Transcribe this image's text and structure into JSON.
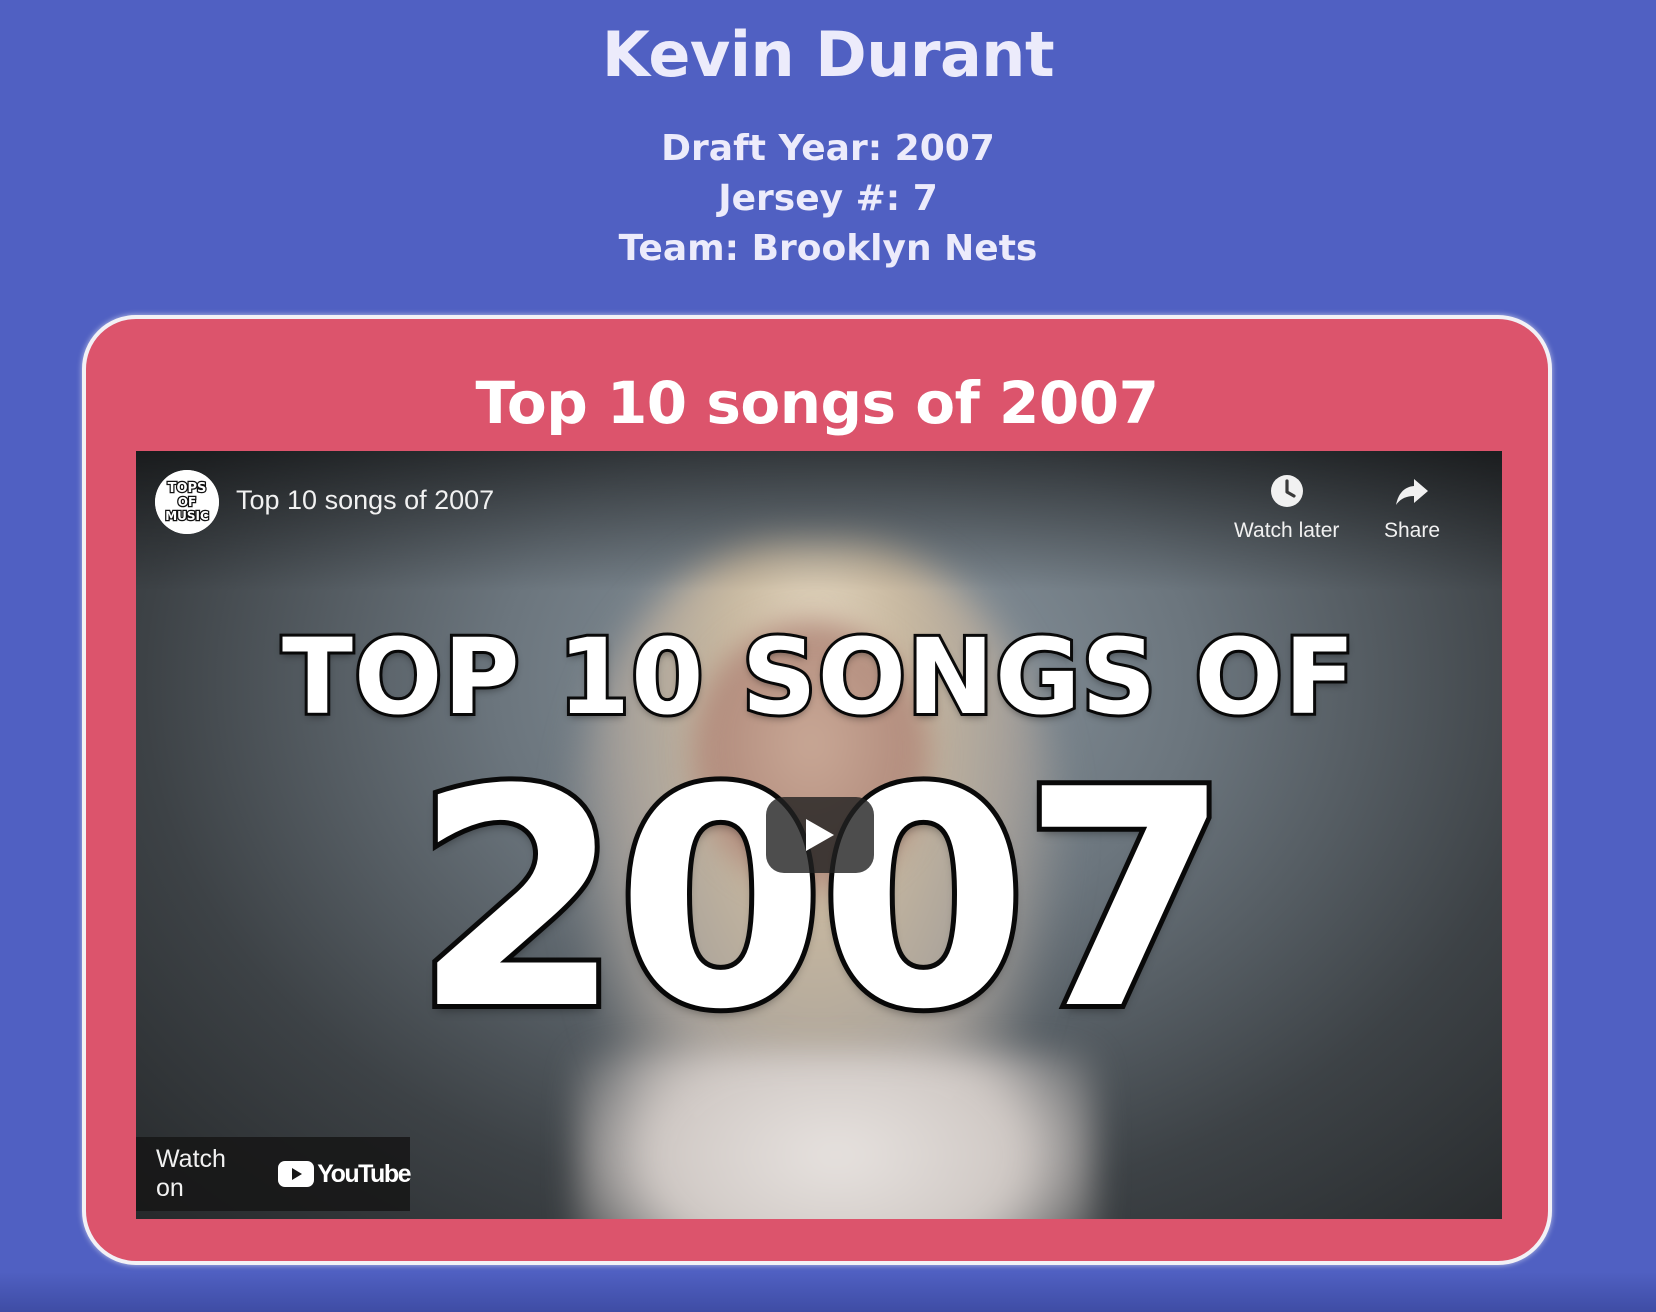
{
  "player": {
    "name": "Kevin Durant",
    "draft_year": "Draft Year: 2007",
    "jersey": "Jersey #: 7",
    "team": "Team: Brooklyn Nets"
  },
  "song_card": {
    "title": "Top 10 songs of 2007",
    "video": {
      "title": "Top 10 songs of 2007",
      "channel_avatar_text": [
        "TOPS",
        "OF",
        "MUSIC"
      ],
      "thumbnail_line1": "TOP 10 SONGS OF",
      "thumbnail_line2": "2007",
      "watch_later_label": "Watch later",
      "share_label": "Share",
      "watch_on_label": "Watch on",
      "youtube_wordmark": "YouTube",
      "icons": {
        "watch_later": "clock-icon",
        "share": "share-arrow-icon",
        "play": "play-icon",
        "youtube": "youtube-logo-icon"
      }
    }
  },
  "colors": {
    "page_background": "#5060c2",
    "card_background": "#dc546c",
    "card_border": "#f2f1f6",
    "header_text": "#ecebfb",
    "youtube_red": "#ff0000"
  }
}
